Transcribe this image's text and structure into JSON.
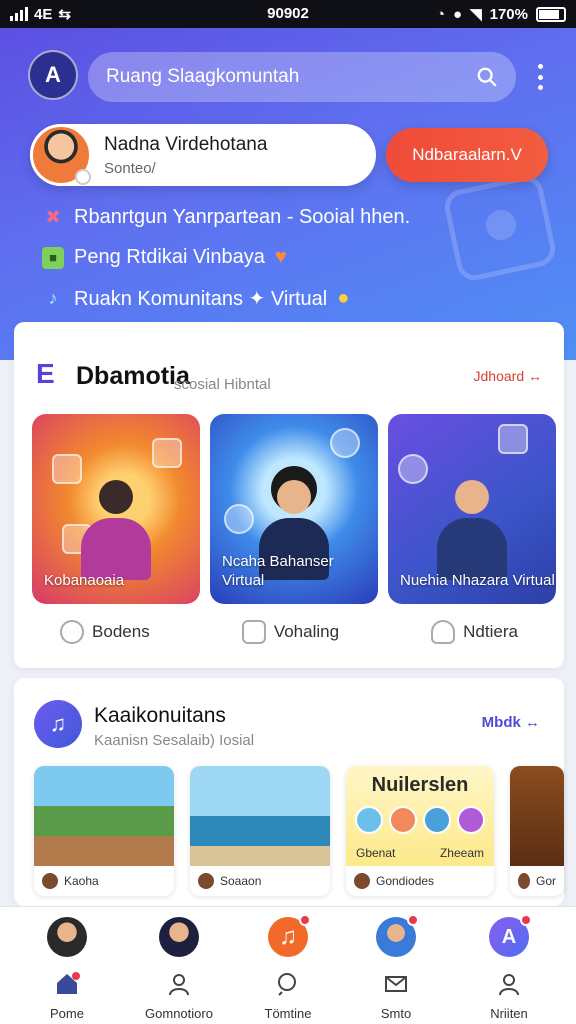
{
  "status_bar": {
    "left_text": "4E",
    "center_text": "90902",
    "battery": "170%"
  },
  "search": {
    "placeholder": "Ruang Slaagkomuntah"
  },
  "profile": {
    "name": "Nadna Virdehotana",
    "subtitle": "Sonteo/"
  },
  "cta_label": "Ndbaraalarn.V",
  "features": [
    {
      "icon": "x-icon",
      "text": "Rbanrtgun Yanrpartean - Sooial hhen."
    },
    {
      "icon": "chat-icon",
      "text": "Peng Rtdikai Vinbaya"
    },
    {
      "icon": "music-icon",
      "text": "Ruakn Komunitans ✦ Virtual"
    }
  ],
  "section1": {
    "title": "Dbamotia",
    "subtitle": "scosial Hibntal",
    "link": "Jdhoard ↔",
    "tiles": [
      {
        "label": "Kobanaoaia"
      },
      {
        "label": "Ncaha Bahanser Virtual"
      },
      {
        "label": "Nuehia Nhazara Virtual"
      }
    ],
    "actions": [
      "Bodens",
      "Vohaling",
      "Ndtiera"
    ]
  },
  "section2": {
    "title": "Kaaikonuitans",
    "subtitle": "Kaanisn Sesalaib) Iosial",
    "link": "Mbdk ↔",
    "cards": [
      {
        "caption": "Kaoha"
      },
      {
        "caption": "Soaaon"
      },
      {
        "title": "Nuilerslen",
        "caption": "Gondiodes",
        "left": "Gbenat",
        "right": "Zheeam"
      },
      {
        "caption": "Gor"
      }
    ]
  },
  "bottom_nav": [
    "Pome",
    "Gomnotioro",
    "Tömtine",
    "Smto",
    "Nriiten"
  ],
  "colors": {
    "hero_start": "#5b4be0",
    "hero_end": "#4f8ff5",
    "accent": "#f04b3a",
    "link_blue": "#4f4bd6"
  }
}
